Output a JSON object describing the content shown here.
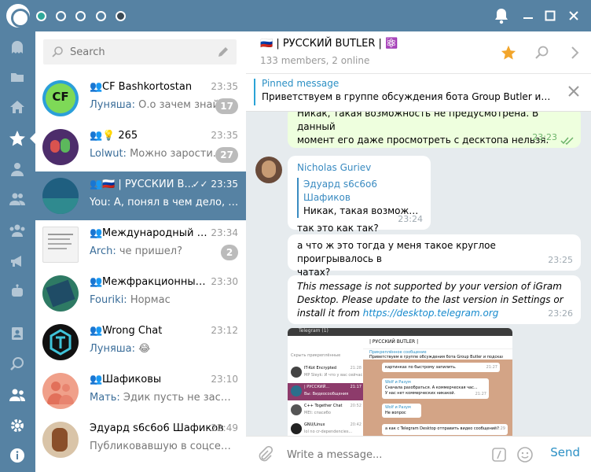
{
  "search": {
    "placeholder": "Search"
  },
  "dialogs": [
    {
      "name": "CF Bashkortostan",
      "time": "23:35",
      "sender": "Луняша:",
      "text": " О.о зачем знайка...",
      "badge": "17",
      "avatar_label": "CF",
      "avatar_color": "#2b9fd9"
    },
    {
      "name": "💡 265",
      "time": "23:35",
      "sender": "Lolwut:",
      "text": " Можно зарости...",
      "badge": "27",
      "avatar_color": "#4d2d6b"
    },
    {
      "name": "🇷🇺 | РУССКИЙ В...",
      "time": "23:35",
      "sender": "You:",
      "text": " А, понял в чем дело, да,...",
      "avatar_color": "#1f5f80"
    },
    {
      "name": "Международный кл...",
      "time": "23:34",
      "sender": "Arch:",
      "text": " че пришел?",
      "badge": "2",
      "avatar_color": "#f3f3f3"
    },
    {
      "name": "Межфракционный ...",
      "time": "23:30",
      "sender": "Fouriki:",
      "text": " Нормас",
      "avatar_color": "#2e7a64"
    },
    {
      "name": "Wrong Chat",
      "time": "23:12",
      "sender": "Луняша:",
      "text": " 😂",
      "avatar_color": "#111111"
    },
    {
      "name": "Шафиковы",
      "time": "23:10",
      "sender": "Мать:",
      "text": " Эдик пусть не засиживае...",
      "avatar_color": "#f0a08a"
    },
    {
      "name": "Эдуард s6c6o6 Шафиков",
      "time": "22:49",
      "sender": "",
      "text": "Публиковавшую в соцсетях и...",
      "avatar_color": "#a06a3a"
    }
  ],
  "header": {
    "title": "🇷🇺 | РУССКИЙ BUTLER | ⚛️",
    "subtitle": "133 members, 2 online"
  },
  "pinned": {
    "label": "Pinned message",
    "text": "Приветствуем в группе обсуждения бота Group Butler и по..."
  },
  "messages": {
    "m1": {
      "line1": "Никак, такая возможность не предусмотрена. В данный",
      "line2": "момент его даже просмотреть с десктопа нельзя.",
      "time": "23:23"
    },
    "m2": {
      "sender": "Nicholas Guriev",
      "reply_name": "Эдуард s6c6o6 Шафиков",
      "reply_text": "Никак, такая возможн...",
      "text": "так это как так?",
      "time": "23:24"
    },
    "m3": {
      "line1": "а что ж это тогда у меня такое круглое проигрывалось в",
      "line2": "чатах?",
      "time": "23:25"
    },
    "m4": {
      "line1": "This message is not supported by your version of iGram",
      "line2": "Desktop. Please update to the last version in Settings or",
      "line3_prefix": "install it from ",
      "link": "https://desktop.telegram.org",
      "time": "23:26"
    }
  },
  "preview": {
    "window_title": "Telegram (1)",
    "chat_title": "| РУССКИЙ BUTLER |",
    "pinned": "Прикреплённое сообщение",
    "pinned_text": "Приветствуем в группе обсуждения бота Group Butler и подсказывай по...",
    "search": "Скрыть прикреплённые",
    "items": [
      {
        "name": "IT-Kot Encrypted",
        "text": "MP Sleyk: И что у вас сейчас",
        "time": "21:28"
      },
      {
        "name": "| РУССКИЙ...",
        "text": "Вы: Видеосообщения",
        "time": "21:17"
      },
      {
        "name": "C++ Together Chat",
        "text": "MEt: спасибо",
        "time": "20:52"
      },
      {
        "name": "GNU/Linux",
        "text": "lol no cr-dependencies...",
        "time": "20:42"
      }
    ],
    "bubbles": [
      {
        "text": "картинках по быстрому запилить.",
        "time": "21:27"
      },
      {
        "name": "Wolf и Разум",
        "text": "Сначала разобраться. А коммерческая час...",
        "sub": "У нас нет коммерческих никакой.",
        "time": "21:27"
      },
      {
        "name": "Wolf и Разум",
        "text": "Не вопрос",
        "time": "21:28"
      },
      {
        "text": "а как с Telegram Desktop отправить видео сообщение?",
        "time": "21:29"
      }
    ]
  },
  "composer": {
    "placeholder": "Write a message...",
    "send_label": "Send"
  },
  "colors": {
    "accent": "#5682a3",
    "link": "#168acd",
    "outgoing": "#eeffde",
    "chat_bg": "#e6ebee"
  }
}
